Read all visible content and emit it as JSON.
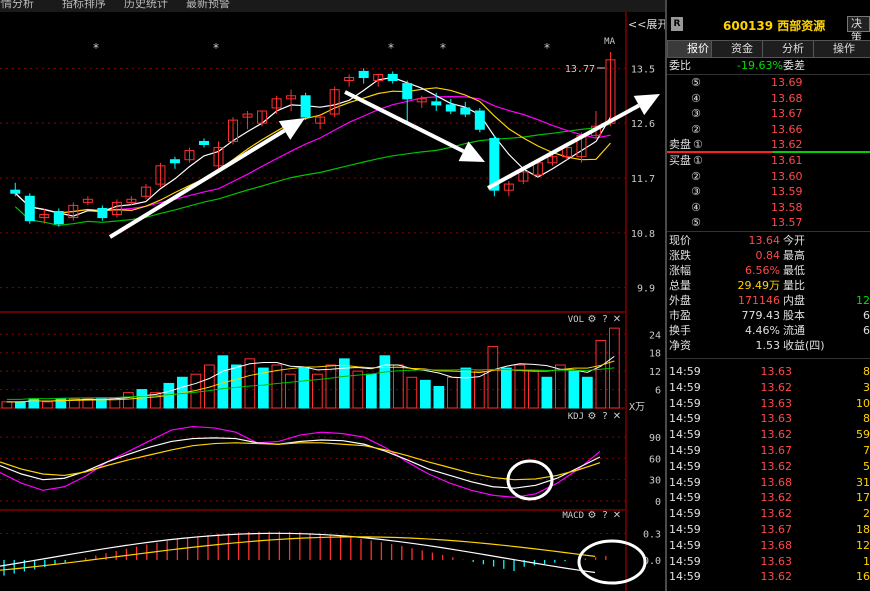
{
  "topbar": {
    "items": [
      "行情分析",
      "指标排序",
      "历史统计",
      "最新预警"
    ]
  },
  "chart": {
    "expand_label": "<<展开",
    "ma_label": "MA",
    "high_annotation": "13.77",
    "price_ticks": [
      "13.5",
      "12.6",
      "11.7",
      "10.8",
      "9.9"
    ],
    "vol_label": "VOL",
    "vol_ticks": [
      "24",
      "18",
      "12",
      "6"
    ],
    "vol_unit": "X万",
    "kdj_label": "KDJ",
    "kdj_ticks": [
      "90",
      "60",
      "30",
      "0"
    ],
    "macd_label": "MACD",
    "macd_ticks": [
      "0.3",
      "0.0"
    ],
    "panel_icons": [
      "gear-icon",
      "help-icon",
      "close-icon"
    ]
  },
  "chart_data": {
    "type": "candlestick",
    "candles": [
      [
        11.5,
        11.45,
        11.62,
        11.4
      ],
      [
        11.4,
        11.0,
        11.45,
        10.95
      ],
      [
        11.05,
        11.1,
        11.2,
        10.95
      ],
      [
        11.15,
        10.95,
        11.2,
        10.9
      ],
      [
        11.05,
        11.25,
        11.3,
        11.0
      ],
      [
        11.3,
        11.35,
        11.4,
        11.25
      ],
      [
        11.2,
        11.05,
        11.25,
        11.0
      ],
      [
        11.1,
        11.3,
        11.35,
        11.05
      ],
      [
        11.3,
        11.35,
        11.4,
        11.25
      ],
      [
        11.4,
        11.55,
        11.6,
        11.35
      ],
      [
        11.6,
        11.9,
        11.95,
        11.55
      ],
      [
        12.0,
        11.95,
        12.05,
        11.85
      ],
      [
        12.0,
        12.15,
        12.2,
        11.95
      ],
      [
        12.3,
        12.25,
        12.35,
        12.2
      ],
      [
        11.9,
        12.2,
        12.3,
        11.85
      ],
      [
        12.3,
        12.65,
        12.7,
        12.25
      ],
      [
        12.7,
        12.75,
        12.8,
        12.5
      ],
      [
        12.6,
        12.8,
        12.8,
        12.55
      ],
      [
        12.85,
        13.0,
        13.05,
        12.75
      ],
      [
        13.0,
        13.05,
        13.15,
        12.8
      ],
      [
        13.05,
        12.7,
        13.1,
        12.65
      ],
      [
        12.6,
        12.7,
        12.75,
        12.5
      ],
      [
        12.75,
        13.15,
        13.2,
        12.7
      ],
      [
        13.3,
        13.35,
        13.4,
        13.2
      ],
      [
        13.45,
        13.35,
        13.5,
        13.25
      ],
      [
        13.3,
        13.4,
        13.4,
        13.2
      ],
      [
        13.4,
        13.3,
        13.45,
        13.25
      ],
      [
        13.25,
        13.0,
        13.3,
        12.6
      ],
      [
        12.95,
        13.0,
        13.05,
        12.85
      ],
      [
        12.95,
        12.9,
        13.1,
        12.8
      ],
      [
        12.9,
        12.8,
        13.0,
        12.75
      ],
      [
        12.85,
        12.75,
        12.95,
        12.7
      ],
      [
        12.8,
        12.5,
        12.85,
        12.45
      ],
      [
        12.35,
        11.5,
        12.4,
        11.4
      ],
      [
        11.5,
        11.6,
        11.65,
        11.4
      ],
      [
        11.65,
        11.8,
        11.85,
        11.6
      ],
      [
        11.75,
        11.95,
        12.0,
        11.7
      ],
      [
        11.95,
        12.05,
        12.1,
        11.9
      ],
      [
        12.05,
        12.2,
        12.25,
        12.0
      ],
      [
        12.05,
        12.4,
        12.45,
        11.95
      ],
      [
        12.4,
        12.55,
        12.8,
        12.35
      ],
      [
        12.6,
        13.64,
        13.77,
        12.55
      ]
    ],
    "volume": [
      2,
      2,
      3,
      2,
      3,
      3,
      3,
      3,
      3,
      5,
      6,
      5,
      8,
      10,
      11,
      14,
      17,
      14,
      16,
      13,
      14,
      11,
      13,
      11,
      14,
      16,
      12,
      11,
      17,
      14,
      10,
      9,
      7,
      10,
      13,
      12,
      20,
      13,
      14,
      12,
      10,
      14,
      12,
      10,
      22,
      26
    ],
    "vol_ylim": [
      0,
      28
    ],
    "price_ylim": [
      9.5,
      13.9
    ],
    "kdj_ylim": [
      -10,
      110
    ],
    "macd_ylim": [
      -0.35,
      0.45
    ]
  },
  "quote": {
    "badge": "R",
    "code": "600139",
    "name": "西部资源",
    "decision_button": "决策",
    "tabs": [
      "报价",
      "资金",
      "分析",
      "操作"
    ],
    "weibi_label": "委比",
    "weibi_value": "-19.63%",
    "weicha_label": "委差",
    "sell_label": "卖盘",
    "buy_label": "买盘",
    "sell_levels": [
      {
        "n": "⑤",
        "price": "13.69"
      },
      {
        "n": "④",
        "price": "13.68"
      },
      {
        "n": "③",
        "price": "13.67"
      },
      {
        "n": "②",
        "price": "13.66"
      },
      {
        "n": "①",
        "price": "13.62"
      }
    ],
    "buy_levels": [
      {
        "n": "①",
        "price": "13.61"
      },
      {
        "n": "②",
        "price": "13.60"
      },
      {
        "n": "③",
        "price": "13.59"
      },
      {
        "n": "④",
        "price": "13.58"
      },
      {
        "n": "⑤",
        "price": "13.57"
      }
    ],
    "stats": [
      {
        "l1": "现价",
        "v1": "13.64",
        "c1": "red",
        "l2": "今开",
        "v2": ""
      },
      {
        "l1": "涨跌",
        "v1": "0.84",
        "c1": "red",
        "l2": "最高",
        "v2": ""
      },
      {
        "l1": "涨幅",
        "v1": "6.56%",
        "c1": "red",
        "l2": "最低",
        "v2": ""
      },
      {
        "l1": "总量",
        "v1": "29.49万",
        "c1": "yellow",
        "l2": "量比",
        "v2": ""
      },
      {
        "l1": "外盘",
        "v1": "171146",
        "c1": "red",
        "l2": "内盘",
        "v2": "12"
      },
      {
        "l1": "市盈",
        "v1": "779.43",
        "c1": "white",
        "l2": "股本",
        "v2": "6"
      },
      {
        "l1": "换手",
        "v1": "4.46%",
        "c1": "white",
        "l2": "流通",
        "v2": "6"
      },
      {
        "l1": "净资",
        "v1": "1.53",
        "c1": "white",
        "l2": "收益(四)",
        "v2": ""
      }
    ],
    "ticks": [
      {
        "time": "14:59",
        "price": "13.63",
        "vol": "8"
      },
      {
        "time": "14:59",
        "price": "13.62",
        "vol": "3"
      },
      {
        "time": "14:59",
        "price": "13.63",
        "vol": "10"
      },
      {
        "time": "14:59",
        "price": "13.63",
        "vol": "8"
      },
      {
        "time": "14:59",
        "price": "13.62",
        "vol": "59"
      },
      {
        "time": "14:59",
        "price": "13.67",
        "vol": "7"
      },
      {
        "time": "14:59",
        "price": "13.62",
        "vol": "5"
      },
      {
        "time": "14:59",
        "price": "13.68",
        "vol": "31"
      },
      {
        "time": "14:59",
        "price": "13.62",
        "vol": "17"
      },
      {
        "time": "14:59",
        "price": "13.62",
        "vol": "2"
      },
      {
        "time": "14:59",
        "price": "13.67",
        "vol": "18"
      },
      {
        "time": "14:59",
        "price": "13.68",
        "vol": "12"
      },
      {
        "time": "14:59",
        "price": "13.63",
        "vol": "1"
      },
      {
        "time": "14:59",
        "price": "13.62",
        "vol": "16"
      }
    ]
  },
  "colors": {
    "up": "#ff3030",
    "down": "#00ffff",
    "ma5": "#ffffff",
    "ma10": "#ffd400",
    "ma20": "#ff00ff",
    "ma60": "#00c000",
    "arrow": "#ffffff",
    "grid": "#8a0000"
  }
}
